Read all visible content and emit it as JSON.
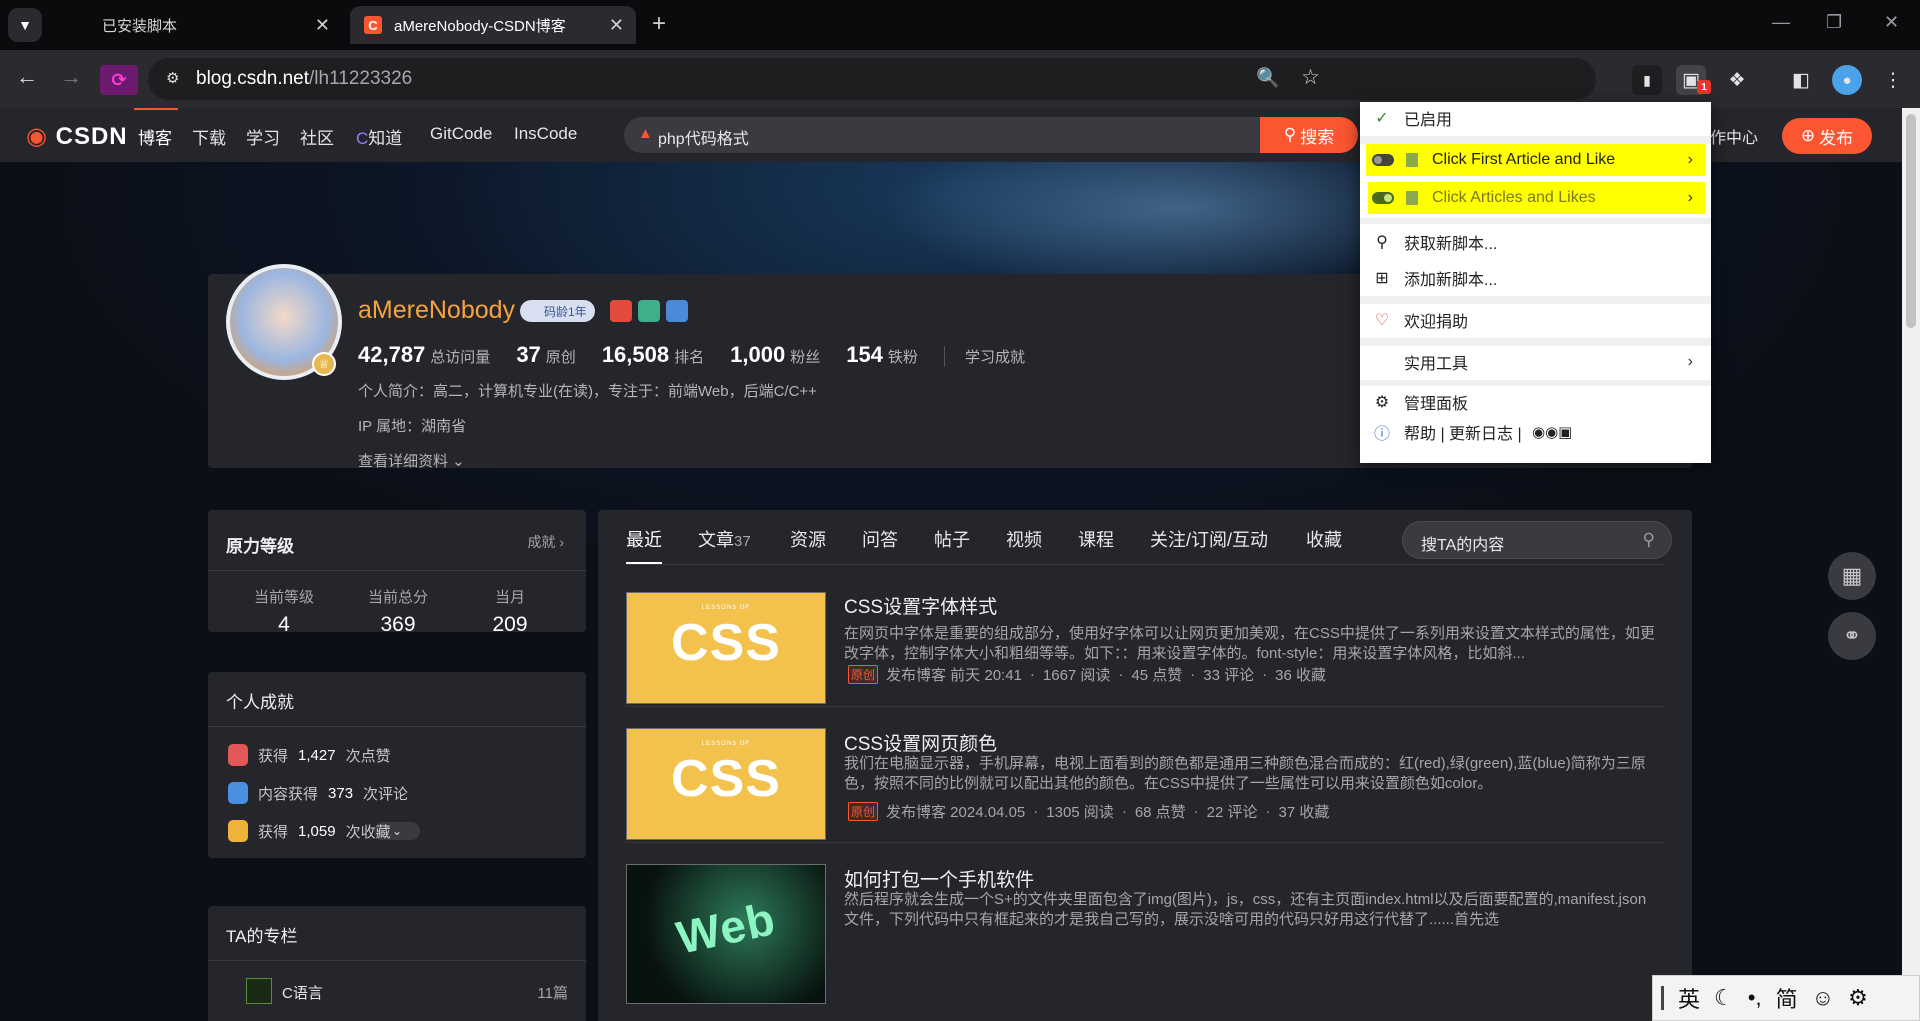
{
  "browser": {
    "tabs": [
      {
        "title": "已安装脚本"
      },
      {
        "title": "aMereNobody-CSDN博客"
      }
    ],
    "url_host": "blog.csdn.net",
    "url_path": "/lh11223326",
    "ext_badge": "1"
  },
  "csdn_nav": {
    "logo": "CSDN",
    "items": [
      "博客",
      "下载",
      "学习",
      "社区",
      "知道",
      "GitCode",
      "InsCode"
    ],
    "search_query": "php代码格式",
    "search_button": "搜索",
    "creator": "作中心",
    "publish": "发布"
  },
  "profile": {
    "name": "aMereNobody",
    "age_badge": "码龄1年",
    "stats": [
      {
        "value": "42,787",
        "label": "总访问量"
      },
      {
        "value": "37",
        "label": "原创"
      },
      {
        "value": "16,508",
        "label": "排名"
      },
      {
        "value": "1,000",
        "label": "粉丝"
      },
      {
        "value": "154",
        "label": "铁粉"
      },
      {
        "value": "",
        "label": "学习成就"
      }
    ],
    "intro": "个人简介：高二，计算机专业(在读)，专注于：前端Web，后端C/C++",
    "ip": "IP 属地：湖南省",
    "more": "查看详细资料"
  },
  "sidebar": {
    "level_title": "原力等级",
    "level_link": "成就",
    "levels": [
      {
        "label": "当前等级",
        "value": "4"
      },
      {
        "label": "当前总分",
        "value": "369"
      },
      {
        "label": "当月",
        "value": "209"
      }
    ],
    "ach_title": "个人成就",
    "achievements": [
      {
        "pre": "获得",
        "num": "1,427",
        "post": "次点赞"
      },
      {
        "pre": "内容获得",
        "num": "373",
        "post": "次评论"
      },
      {
        "pre": "获得",
        "num": "1,059",
        "post": "次收藏"
      }
    ],
    "column_title": "TA的专栏",
    "columns": [
      {
        "name": "C语言",
        "count": "11篇"
      }
    ]
  },
  "main": {
    "tabs": [
      {
        "label": "最近"
      },
      {
        "label": "文章",
        "count": "37"
      },
      {
        "label": "资源"
      },
      {
        "label": "问答"
      },
      {
        "label": "帖子"
      },
      {
        "label": "视频"
      },
      {
        "label": "课程"
      },
      {
        "label": "关注/订阅/互动"
      },
      {
        "label": "收藏"
      }
    ],
    "search_placeholder": "搜TA的内容",
    "articles": [
      {
        "thumb": "CSS",
        "thumb_sub": "LESSONS OF",
        "title": "CSS设置字体样式",
        "desc": "在网页中字体是重要的组成部分，使用好字体可以让网页更加美观，在CSS中提供了一系列用来设置文本样式的属性，如更改字体，控制字体大小和粗细等等。如下：：用来设置字体的。font-style：用来设置字体风格，比如斜...",
        "tag": "原创",
        "time": "发布博客 前天 20:41",
        "reads": "1667 阅读",
        "likes": "45 点赞",
        "comments": "33 评论",
        "favs": "36 收藏"
      },
      {
        "thumb": "CSS",
        "thumb_sub": "LESSONS OF",
        "title": "CSS设置网页颜色",
        "desc": "我们在电脑显示器，手机屏幕，电视上面看到的颜色都是通用三种颜色混合而成的：红(red),绿(green),蓝(blue)简称为三原色，按照不同的比例就可以配出其他的颜色。在CSS中提供了一些属性可以用来设置颜色如color。",
        "tag": "原创",
        "time": "发布博客 2024.04.05",
        "reads": "1305 阅读",
        "likes": "68 点赞",
        "comments": "22 评论",
        "favs": "37 收藏"
      },
      {
        "thumb": "Web",
        "thumb_sub": "",
        "title": "如何打包一个手机软件",
        "desc": "然后程序就会生成一个S+的文件夹里面包含了img(图片)，js，css，还有主页面index.html以及后面要配置的,manifest.json文件，下列代码中只有框起来的才是我自己写的，展示没啥可用的代码只好用这行代替了......首先选"
      }
    ]
  },
  "ext_menu": {
    "enabled": "已启用",
    "scripts": [
      "Click First Article and Like",
      "Click Articles and Likes"
    ],
    "get_new": "获取新脚本...",
    "add_new": "添加新脚本...",
    "donate": "欢迎捐助",
    "tools": "实用工具",
    "dashboard": "管理面板",
    "help": "帮助 | 更新日志 |"
  },
  "ime": {
    "lang": "英",
    "mode": "简"
  }
}
